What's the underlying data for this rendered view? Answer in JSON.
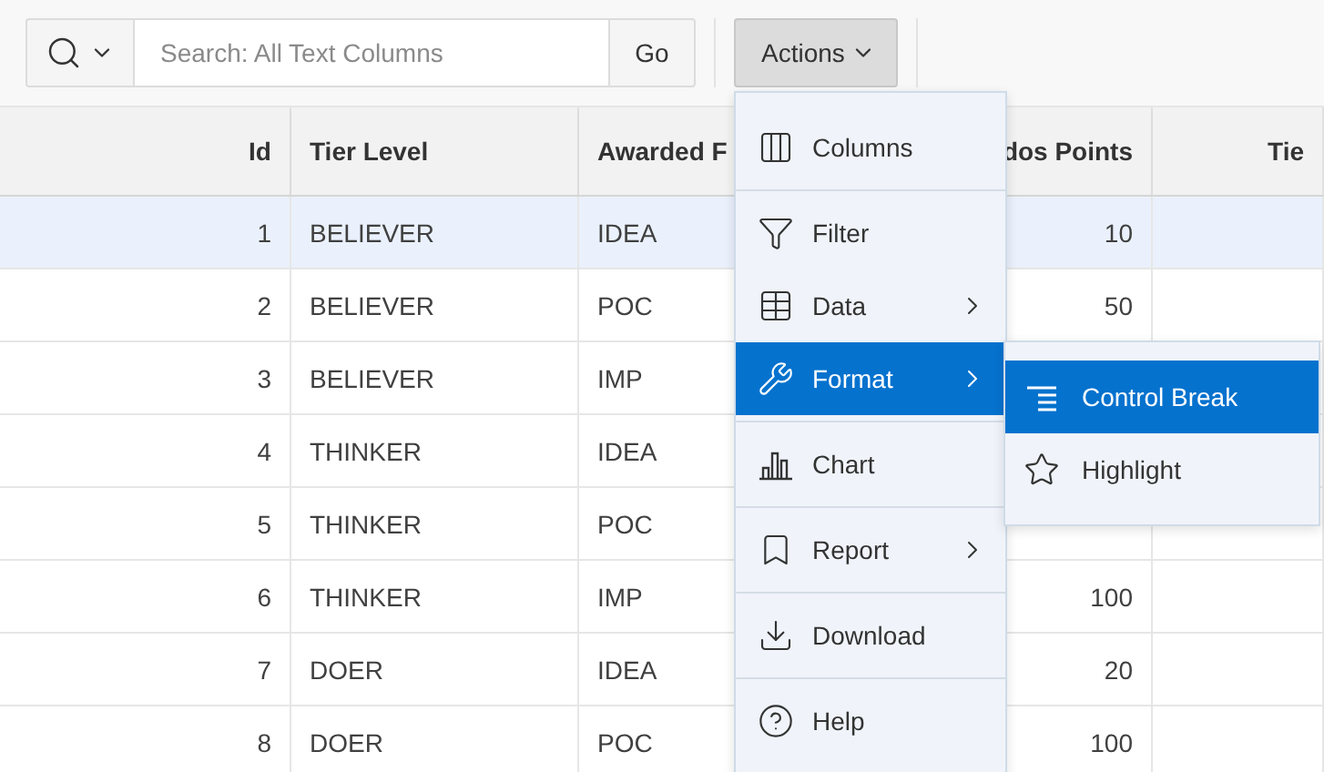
{
  "toolbar": {
    "search": {
      "placeholder": "Search: All Text Columns"
    },
    "go_button": "Go",
    "actions_button": {
      "label": "Actions",
      "expanded": true
    }
  },
  "table": {
    "columns": [
      "Id",
      "Tier Level",
      "Awarded F",
      "dos Points",
      "Tie"
    ],
    "rows": [
      {
        "id": "1",
        "tier": "BELIEVER",
        "awarded": "IDEA",
        "kudos": "10",
        "selected": true
      },
      {
        "id": "2",
        "tier": "BELIEVER",
        "awarded": "POC",
        "kudos": "50",
        "selected": false
      },
      {
        "id": "3",
        "tier": "BELIEVER",
        "awarded": "IMP",
        "selected": false
      },
      {
        "id": "4",
        "tier": "THINKER",
        "awarded": "IDEA",
        "selected": false
      },
      {
        "id": "5",
        "tier": "THINKER",
        "awarded": "POC",
        "selected": false
      },
      {
        "id": "6",
        "tier": "THINKER",
        "awarded": "IMP",
        "kudos": "100",
        "selected": false
      },
      {
        "id": "7",
        "tier": "DOER",
        "awarded": "IDEA",
        "kudos": "20",
        "selected": false
      },
      {
        "id": "8",
        "tier": "DOER",
        "awarded": "POC",
        "kudos": "100",
        "selected": false
      }
    ]
  },
  "actions_menu": {
    "groups": [
      [
        {
          "label": "Columns",
          "submenu": false,
          "selected": false
        }
      ],
      [
        {
          "label": "Filter",
          "submenu": false,
          "selected": false
        },
        {
          "label": "Data",
          "submenu": true,
          "selected": false
        },
        {
          "label": "Format",
          "submenu": true,
          "selected": true
        }
      ],
      [
        {
          "label": "Chart",
          "submenu": false,
          "selected": false
        }
      ],
      [
        {
          "label": "Report",
          "submenu": true,
          "selected": false
        }
      ],
      [
        {
          "label": "Download",
          "submenu": false,
          "selected": false
        }
      ],
      [
        {
          "label": "Help",
          "submenu": false,
          "selected": false
        }
      ]
    ]
  },
  "format_submenu": {
    "items": [
      {
        "label": "Control Break",
        "selected": true
      },
      {
        "label": "Highlight",
        "selected": false
      }
    ]
  }
}
